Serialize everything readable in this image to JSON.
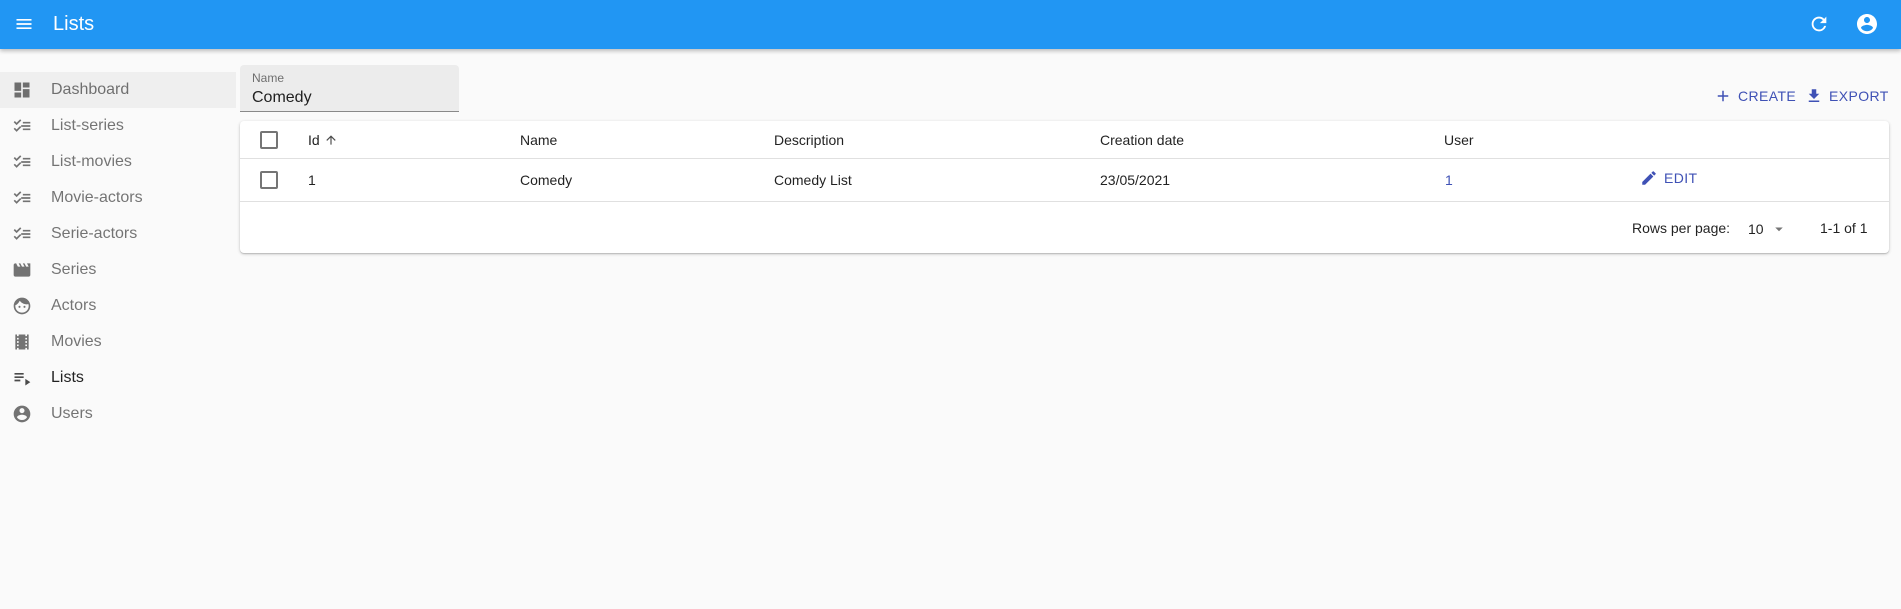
{
  "appbar": {
    "title": "Lists"
  },
  "sidebar": {
    "items": [
      {
        "label": "Dashboard",
        "icon": "dashboard-icon"
      },
      {
        "label": "List-series",
        "icon": "checklist-icon"
      },
      {
        "label": "List-movies",
        "icon": "checklist-icon"
      },
      {
        "label": "Movie-actors",
        "icon": "checklist-icon"
      },
      {
        "label": "Serie-actors",
        "icon": "checklist-icon"
      },
      {
        "label": "Series",
        "icon": "movie-clapper-icon"
      },
      {
        "label": "Actors",
        "icon": "face-icon"
      },
      {
        "label": "Movies",
        "icon": "film-strip-icon"
      },
      {
        "label": "Lists",
        "icon": "playlist-icon"
      },
      {
        "label": "Users",
        "icon": "account-circle-icon"
      }
    ]
  },
  "filter": {
    "label": "Name",
    "value": "Comedy"
  },
  "toolbar": {
    "create_label": "CREATE",
    "export_label": "EXPORT"
  },
  "table": {
    "columns": [
      "Id",
      "Name",
      "Description",
      "Creation date",
      "User"
    ],
    "rows": [
      {
        "id": "1",
        "name": "Comedy",
        "description": "Comedy List",
        "creation_date": "23/05/2021",
        "user": "1",
        "edit_label": "EDIT"
      }
    ]
  },
  "pagination": {
    "rows_per_page_label": "Rows per page:",
    "rows_per_page": "10",
    "range": "1-1 of 1"
  },
  "colors": {
    "appbar": "#2196f3",
    "accent": "#3f51b5",
    "background": "#fafafa"
  }
}
